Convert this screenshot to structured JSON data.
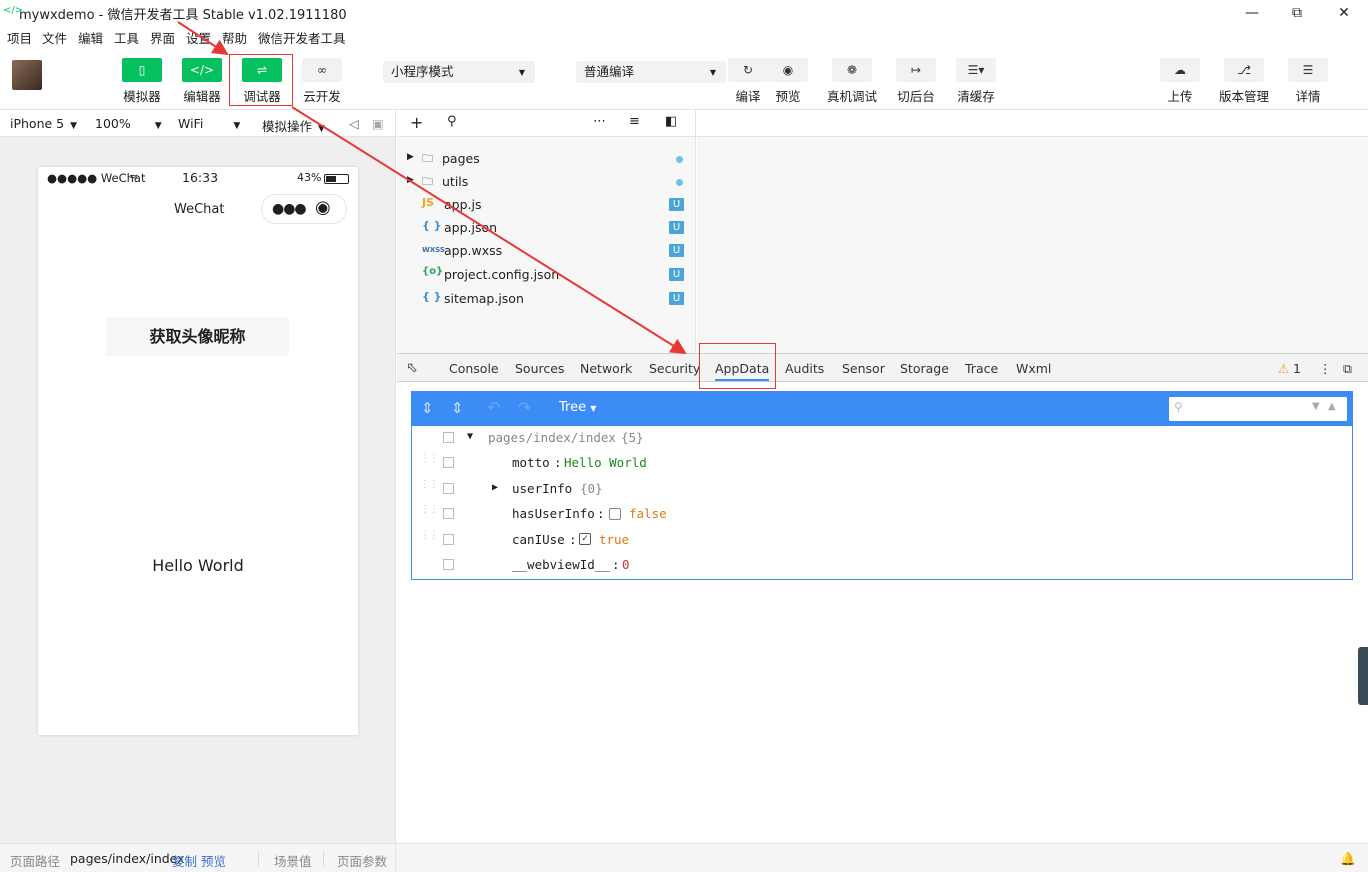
{
  "window": {
    "title": "mywxdemo - 微信开发者工具 Stable v1.02.1911180",
    "icon": "</>"
  },
  "menu": [
    "项目",
    "文件",
    "编辑",
    "工具",
    "界面",
    "设置",
    "帮助",
    "微信开发者工具"
  ],
  "toolbar": {
    "simulator": "模拟器",
    "editor": "编辑器",
    "debugger": "调试器",
    "cloud": "云开发",
    "mode": "小程序模式",
    "compile_mode": "普通编译",
    "compile": "编译",
    "preview": "预览",
    "remote_debug": "真机调试",
    "background": "切后台",
    "clear_cache": "清缓存",
    "upload": "上传",
    "version": "版本管理",
    "details": "详情"
  },
  "simbar": {
    "device": "iPhone 5",
    "zoom": "100%",
    "network": "WiFi",
    "ops": "模拟操作"
  },
  "phone": {
    "carrier": "●●●●● WeChat",
    "time": "16:33",
    "battery": "43%",
    "nav_title": "WeChat",
    "button": "获取头像昵称",
    "motto": "Hello World"
  },
  "files": [
    {
      "name": "pages",
      "type": "folder"
    },
    {
      "name": "utils",
      "type": "folder"
    },
    {
      "name": "app.js",
      "type": "js",
      "badge": "U"
    },
    {
      "name": "app.json",
      "type": "json",
      "badge": "U"
    },
    {
      "name": "app.wxss",
      "type": "wxss",
      "badge": "U"
    },
    {
      "name": "project.config.json",
      "type": "config",
      "badge": "U"
    },
    {
      "name": "sitemap.json",
      "type": "json",
      "badge": "U"
    }
  ],
  "file_icons": {
    "js": "JS",
    "json": "{ }",
    "wxss": "WXSS",
    "config": "{o}"
  },
  "devtools": {
    "tabs": [
      "Console",
      "Sources",
      "Network",
      "Security",
      "AppData",
      "Audits",
      "Sensor",
      "Storage",
      "Trace",
      "Wxml"
    ],
    "active_tab": "AppData",
    "warnings": "1",
    "view_mode": "Tree"
  },
  "appdata": {
    "root": "pages/index/index",
    "root_count": "{5}",
    "items": [
      {
        "key": "motto",
        "value": "Hello World",
        "kind": "string"
      },
      {
        "key": "userInfo",
        "value": "{0}",
        "kind": "object"
      },
      {
        "key": "hasUserInfo",
        "value": "false",
        "kind": "bool",
        "checked": false
      },
      {
        "key": "canIUse",
        "value": "true",
        "kind": "bool",
        "checked": true
      },
      {
        "key": "__webviewId__",
        "value": "0",
        "kind": "number"
      }
    ]
  },
  "status": {
    "path_label": "页面路径",
    "path": "pages/index/index",
    "copy": "复制",
    "preview": "预览",
    "scene": "场景值",
    "params": "页面参数"
  },
  "colors": {
    "accent": "#07c160",
    "highlight": "#e53935",
    "appdata_bar": "#3c8cf5"
  }
}
